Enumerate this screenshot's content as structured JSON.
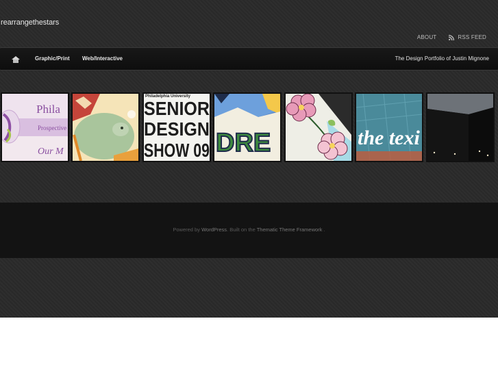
{
  "site": {
    "title": "rearrangethestars"
  },
  "top_links": {
    "about": "ABOUT",
    "rss": "RSS FEED"
  },
  "nav": {
    "items": [
      "Graphic/Print",
      "Web/Interactive"
    ],
    "tagline": "The Design Portfolio of Justin Mignone"
  },
  "thumbs": {
    "t1": {
      "line1": "Phila",
      "line2": "Prospective",
      "line3": "Our M"
    },
    "t3": {
      "top": "Philadelphia University",
      "line1": "SENIOR",
      "line2": "DESIGN",
      "line3": "SHOW 09"
    },
    "t4": {
      "word": "DRE"
    },
    "t6": {
      "word": "the texi"
    }
  },
  "footer": {
    "powered": "Powered by",
    "wordpress": "WordPress",
    "built": ". Built on the",
    "thematic": "Thematic Theme Framework",
    "end": "."
  },
  "colors": {
    "page_bg": "#2a2a2a",
    "nav_bg": "#111111",
    "footer_bg": "#131313"
  }
}
